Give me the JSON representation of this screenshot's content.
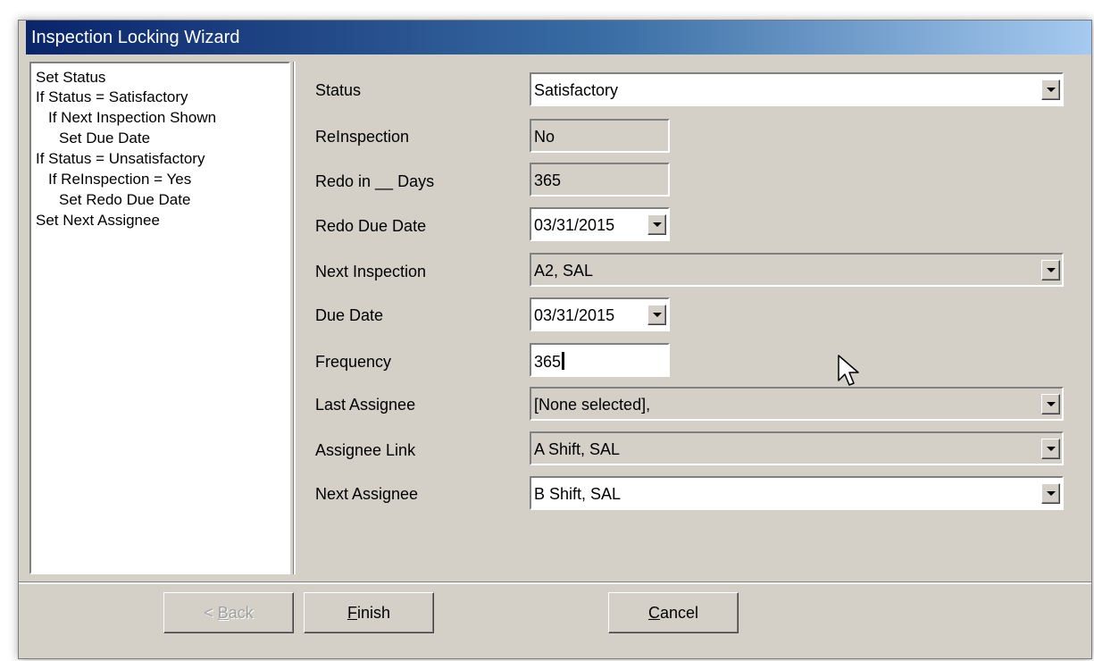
{
  "window": {
    "title": "Inspection Locking Wizard"
  },
  "steps": [
    "Set Status",
    "If Status = Satisfactory",
    "If Next Inspection Shown",
    "Set Due Date",
    "If Status = Unsatisfactory",
    "If ReInspection = Yes",
    "Set Redo Due Date",
    "Set Next Assignee"
  ],
  "fields": {
    "status": {
      "label": "Status",
      "value": "Satisfactory"
    },
    "reinspection": {
      "label": "ReInspection",
      "value": "No"
    },
    "redo_days": {
      "label": "Redo in __ Days",
      "value": "365"
    },
    "redo_due_date": {
      "label": "Redo Due Date",
      "value": "03/31/2015"
    },
    "next_inspection": {
      "label": "Next Inspection",
      "value": "A2, SAL"
    },
    "due_date": {
      "label": "Due Date",
      "value": "03/31/2015"
    },
    "frequency": {
      "label": "Frequency",
      "value": "365"
    },
    "last_assignee": {
      "label": "Last Assignee",
      "value": "[None selected],"
    },
    "assignee_link": {
      "label": "Assignee Link",
      "value": "A Shift, SAL"
    },
    "next_assignee": {
      "label": "Next Assignee",
      "value": "B Shift, SAL"
    }
  },
  "buttons": {
    "back": {
      "prefix": "< ",
      "mnemonic": "B",
      "rest": "ack"
    },
    "finish": {
      "mnemonic": "F",
      "rest": "inish"
    },
    "cancel": {
      "mnemonic": "C",
      "rest": "ancel"
    }
  },
  "colors": {
    "window_bg": "#d4d0c8",
    "title_gradient_start": "#0a246a",
    "title_gradient_end": "#a6caf0"
  }
}
